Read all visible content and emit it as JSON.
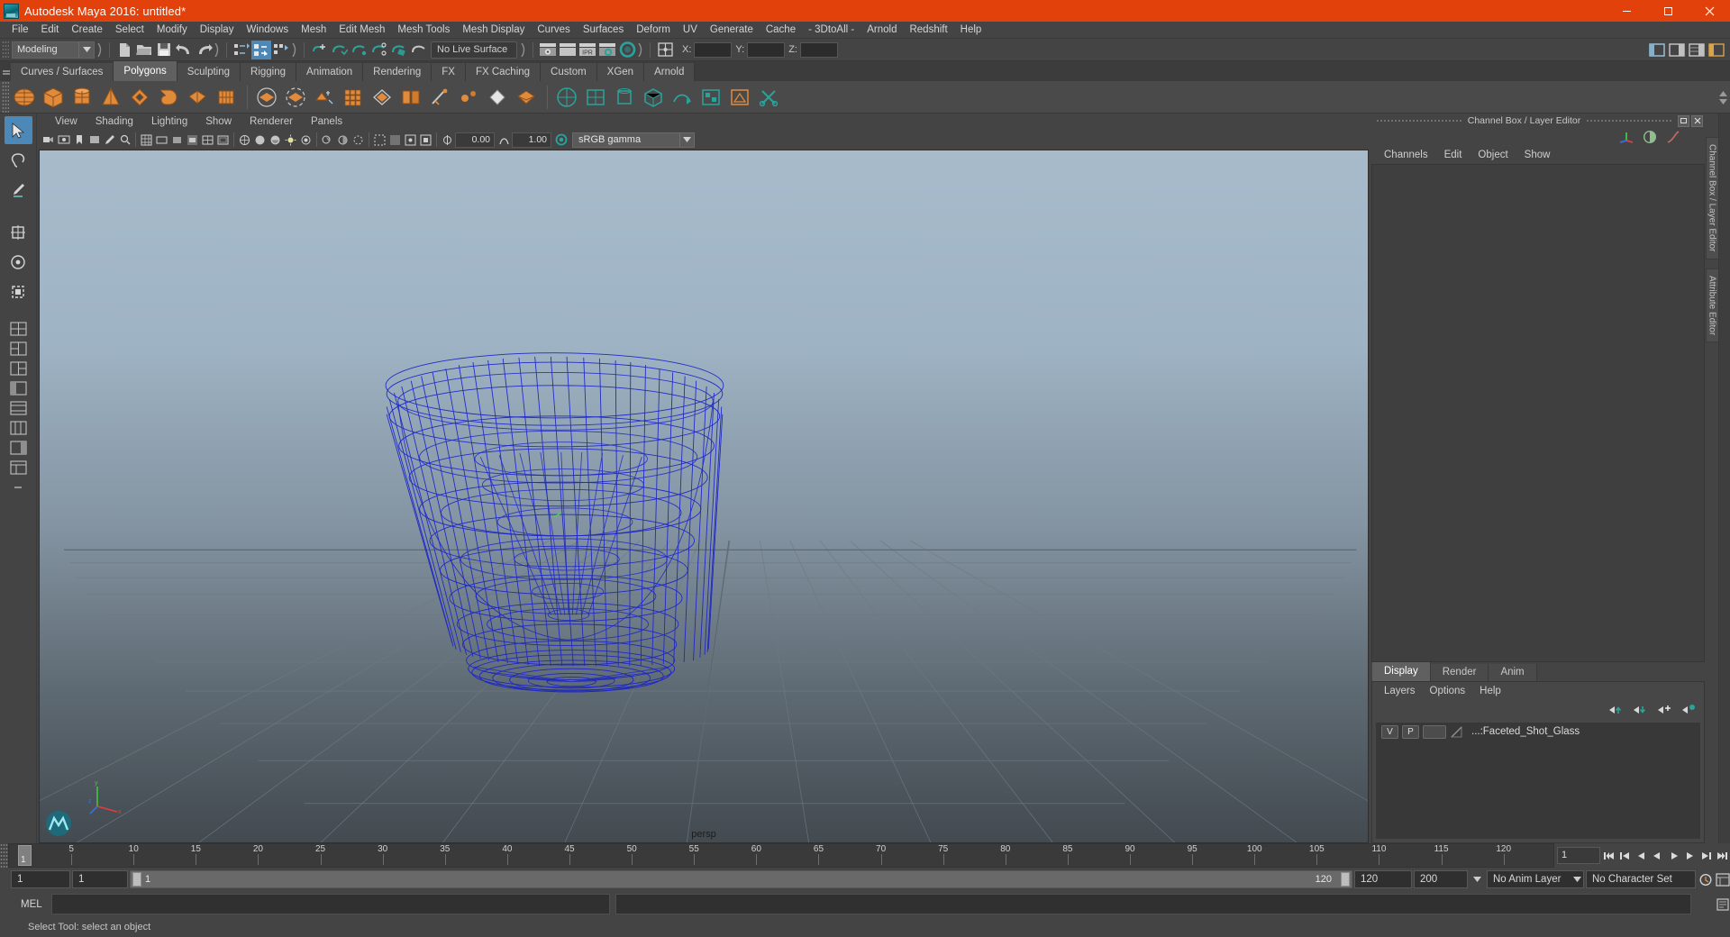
{
  "window": {
    "title": "Autodesk Maya 2016: untitled*",
    "icon": "maya-logo-icon",
    "minimize": "minimize-button",
    "maximize": "maximize-button",
    "close": "close-button"
  },
  "menubar": {
    "items": [
      "File",
      "Edit",
      "Create",
      "Select",
      "Modify",
      "Display",
      "Windows",
      "Mesh",
      "Edit Mesh",
      "Mesh Tools",
      "Mesh Display",
      "Curves",
      "Surfaces",
      "Deform",
      "UV",
      "Generate",
      "Cache",
      "- 3DtoAll -",
      "Arnold",
      "Redshift",
      "Help"
    ]
  },
  "statusbar": {
    "mode": "Modeling",
    "live_surface": "No Live Surface",
    "x_label": "X:",
    "y_label": "Y:",
    "z_label": "Z:",
    "x_value": "",
    "y_value": "",
    "z_value": ""
  },
  "shelf": {
    "tabs": [
      "Curves / Surfaces",
      "Polygons",
      "Sculpting",
      "Rigging",
      "Animation",
      "Rendering",
      "FX",
      "FX Caching",
      "Custom",
      "XGen",
      "Arnold"
    ],
    "active_tab": "Polygons"
  },
  "viewport": {
    "panel_menus": [
      "View",
      "Shading",
      "Lighting",
      "Show",
      "Renderer",
      "Panels"
    ],
    "camera_label": "persp",
    "exposure_value": "0.00",
    "gamma_value": "1.00",
    "color_space": "sRGB gamma",
    "axis_x": "x",
    "axis_y": "y",
    "axis_z": "z"
  },
  "channel_box": {
    "dock_title": "Channel Box / Layer Editor",
    "menus": [
      "Channels",
      "Edit",
      "Object",
      "Show"
    ],
    "side_tabs": [
      "Channel Box / Layer Editor",
      "Attribute Editor"
    ]
  },
  "layer_editor": {
    "tabs": [
      "Display",
      "Render",
      "Anim"
    ],
    "active_tab": "Display",
    "menus": [
      "Layers",
      "Options",
      "Help"
    ],
    "layers": [
      {
        "visibility": "V",
        "playback": "P",
        "name": "...:Faceted_Shot_Glass"
      }
    ]
  },
  "timeline": {
    "current_frame": "1",
    "frame_field": "1",
    "ticks": [
      {
        "label": "5",
        "value": 5
      },
      {
        "label": "10",
        "value": 10
      },
      {
        "label": "15",
        "value": 15
      },
      {
        "label": "20",
        "value": 20
      },
      {
        "label": "25",
        "value": 25
      },
      {
        "label": "30",
        "value": 30
      },
      {
        "label": "35",
        "value": 35
      },
      {
        "label": "40",
        "value": 40
      },
      {
        "label": "45",
        "value": 45
      },
      {
        "label": "50",
        "value": 50
      },
      {
        "label": "55",
        "value": 55
      },
      {
        "label": "60",
        "value": 60
      },
      {
        "label": "65",
        "value": 65
      },
      {
        "label": "70",
        "value": 70
      },
      {
        "label": "75",
        "value": 75
      },
      {
        "label": "80",
        "value": 80
      },
      {
        "label": "85",
        "value": 85
      },
      {
        "label": "90",
        "value": 90
      },
      {
        "label": "95",
        "value": 95
      },
      {
        "label": "100",
        "value": 100
      },
      {
        "label": "105",
        "value": 105
      },
      {
        "label": "110",
        "value": 110
      },
      {
        "label": "115",
        "value": 115
      },
      {
        "label": "120",
        "value": 120
      }
    ]
  },
  "range": {
    "start": "1",
    "anim_start": "1",
    "slider_start": "1",
    "slider_end": "120",
    "anim_end": "120",
    "end": "200",
    "anim_layer": "No Anim Layer",
    "character_set": "No Character Set"
  },
  "command_line": {
    "language": "MEL",
    "input_value": "",
    "placeholder": ""
  },
  "status": {
    "message": "Select Tool: select an object"
  },
  "colors": {
    "title_bar": "#e2410c",
    "accent_selected": "#4c89b8",
    "shelf_icon": "#e08a3c",
    "shelf_icon_teal": "#2aa39b",
    "wireframe": "#1b24c8",
    "panel_bg": "#444444"
  }
}
